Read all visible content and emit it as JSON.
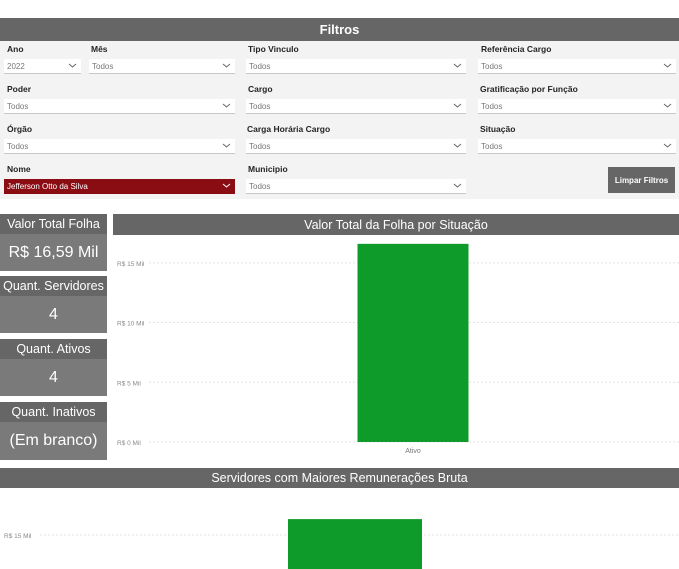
{
  "filters": {
    "title": "Filtros",
    "fields": [
      {
        "label": "Ano",
        "value": "2022"
      },
      {
        "label": "Mês",
        "value": "Todos"
      },
      {
        "label": "Tipo Vinculo",
        "value": "Todos"
      },
      {
        "label": "Referência Cargo",
        "value": "Todos"
      },
      {
        "label": "Poder",
        "value": "Todos"
      },
      {
        "label": "Cargo",
        "value": "Todos"
      },
      {
        "label": "Gratificação por Função",
        "value": "Todos"
      },
      {
        "label": "Órgão",
        "value": "Todos"
      },
      {
        "label": "Carga Horária Cargo",
        "value": "Todos"
      },
      {
        "label": "Situação",
        "value": "Todos"
      },
      {
        "label": "Nome",
        "value": "Jefferson Otto da Silva"
      },
      {
        "label": "Municipio",
        "value": "Todos"
      }
    ],
    "clear_button": "Limpar Filtros",
    "selected_color": "#8b0d14"
  },
  "kpis": [
    {
      "title": "Valor Total Folha",
      "value": "R$ 16,59 Mil"
    },
    {
      "title": "Quant. Servidores",
      "value": "4"
    },
    {
      "title": "Quant. Ativos",
      "value": "4"
    },
    {
      "title": "Quant. Inativos",
      "value": "(Em branco)"
    }
  ],
  "chart_data": [
    {
      "type": "bar",
      "title": "Valor Total da Folha por Situação",
      "categories": [
        "Ativo"
      ],
      "values": [
        16.59
      ],
      "unit": "Mil",
      "ytick_values": [
        0,
        5,
        10,
        15
      ],
      "ytick_labels": [
        "R$ 0 Mil",
        "R$ 5 Mil",
        "R$ 10 Mil",
        "R$ 15 Mil"
      ],
      "ylim": [
        0,
        18
      ],
      "grid": true,
      "bar_color": "#0f9b2a"
    },
    {
      "type": "bar",
      "title": "Servidores com Maiores Remunerações Bruta",
      "categories": [],
      "values": [
        16.59
      ],
      "unit": "Mil",
      "ytick_values": [
        15
      ],
      "ytick_labels": [
        "R$ 15 Mil"
      ],
      "ylim": [
        0,
        18
      ],
      "grid": true,
      "bar_color": "#0f9b2a"
    }
  ]
}
